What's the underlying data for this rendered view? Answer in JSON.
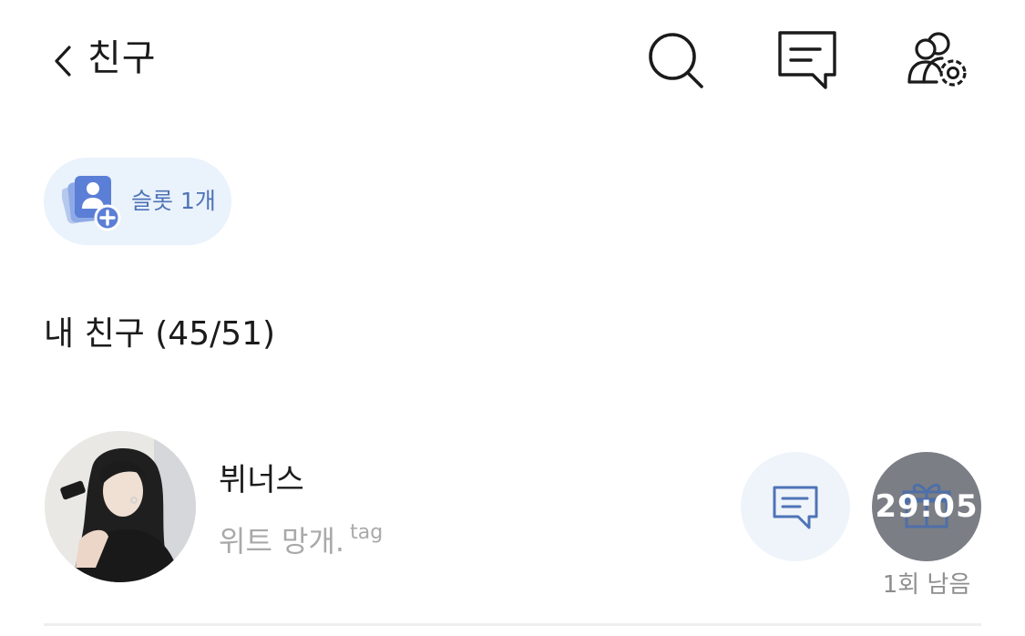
{
  "header": {
    "back_icon": "chevron-left-icon",
    "title": "친구",
    "actions": [
      {
        "icon": "search-icon"
      },
      {
        "icon": "message-icon"
      },
      {
        "icon": "friend-settings-icon"
      }
    ]
  },
  "slot_chip": {
    "icon": "add-friend-slot-icon",
    "label": "슬롯 1개"
  },
  "friends_section": {
    "title": "내 친구 (45/51)"
  },
  "friends": [
    {
      "name": "뷔너스",
      "status_message": "위트 망개.",
      "status_tag": "tag",
      "message_icon": "message-icon",
      "gift_timer": "29:05",
      "gift_remaining": "1회 남음"
    }
  ],
  "colors": {
    "accent": "#4e73b7",
    "chip_bg": "#eaf2fb",
    "button_bg": "#eff4fa",
    "timer_bg": "#7b7e85",
    "secondary_text": "#a9a9a9"
  }
}
